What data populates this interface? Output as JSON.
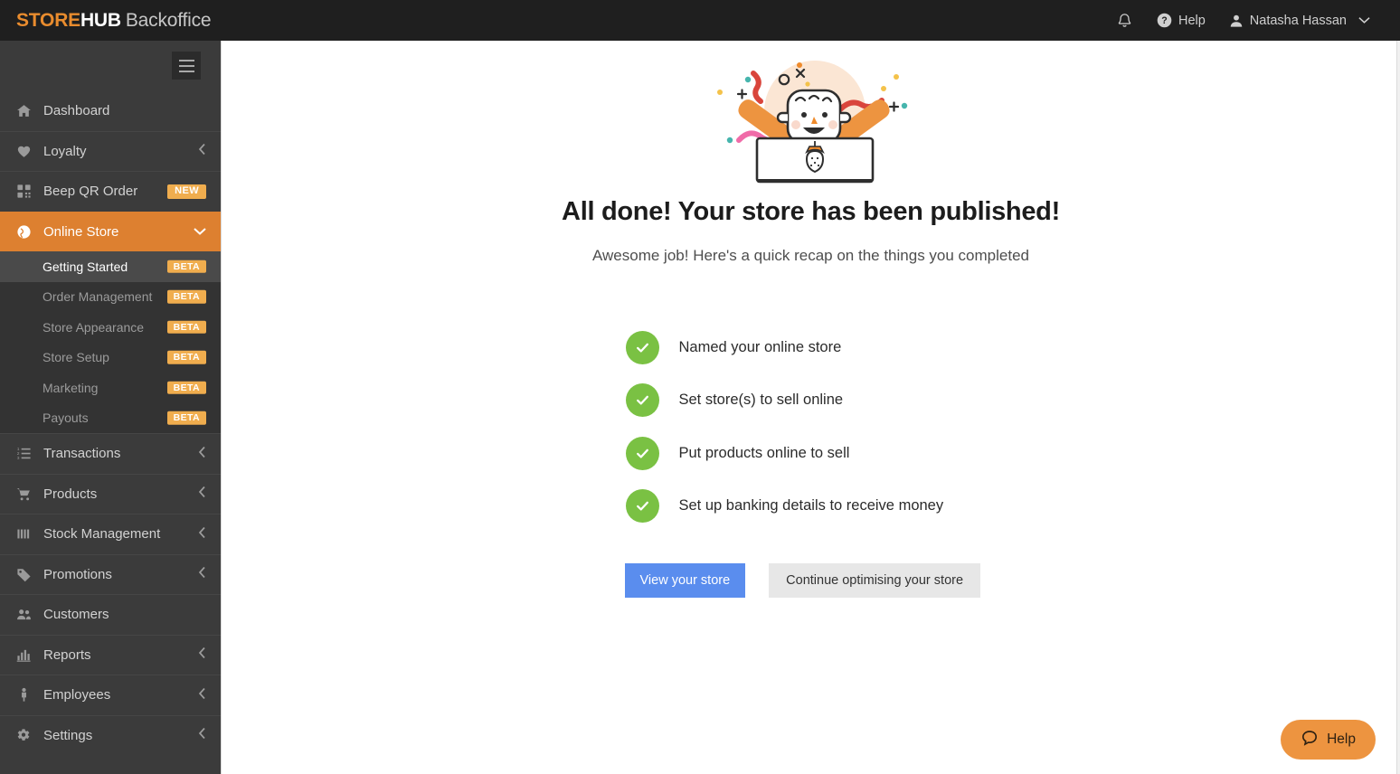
{
  "header": {
    "brand_part1": "STORE",
    "brand_part2": "HUB",
    "brand_part3": "Backoffice",
    "notifications_icon": "bell-icon",
    "help_label": "Help",
    "user_name": "Natasha Hassan"
  },
  "sidebar": {
    "menu_toggle": "hamburger-icon",
    "items": [
      {
        "label": "Dashboard",
        "icon": "home-icon",
        "chevron": "none",
        "badge": ""
      },
      {
        "label": "Loyalty",
        "icon": "heart-icon",
        "chevron": "left",
        "badge": ""
      },
      {
        "label": "Beep QR Order",
        "icon": "qr-code-icon",
        "chevron": "none",
        "badge": "NEW"
      },
      {
        "label": "Online Store",
        "icon": "globe-icon",
        "chevron": "down",
        "badge": "",
        "active": true
      },
      {
        "label": "Transactions",
        "icon": "list-ol-icon",
        "chevron": "left",
        "badge": ""
      },
      {
        "label": "Products",
        "icon": "cart-icon",
        "chevron": "left",
        "badge": ""
      },
      {
        "label": "Stock Management",
        "icon": "bars-icon",
        "chevron": "left",
        "badge": ""
      },
      {
        "label": "Promotions",
        "icon": "tag-icon",
        "chevron": "left",
        "badge": ""
      },
      {
        "label": "Customers",
        "icon": "users-icon",
        "chevron": "none",
        "badge": ""
      },
      {
        "label": "Reports",
        "icon": "chart-bar-icon",
        "chevron": "left",
        "badge": ""
      },
      {
        "label": "Employees",
        "icon": "person-icon",
        "chevron": "left",
        "badge": ""
      },
      {
        "label": "Settings",
        "icon": "gears-icon",
        "chevron": "left",
        "badge": ""
      }
    ],
    "submenu": [
      {
        "label": "Getting Started",
        "badge": "BETA",
        "active": true
      },
      {
        "label": "Order Management",
        "badge": "BETA",
        "active": false
      },
      {
        "label": "Store Appearance",
        "badge": "BETA",
        "active": false
      },
      {
        "label": "Store Setup",
        "badge": "BETA",
        "active": false
      },
      {
        "label": "Marketing",
        "badge": "BETA",
        "active": false
      },
      {
        "label": "Payouts",
        "badge": "BETA",
        "active": false
      }
    ]
  },
  "main": {
    "illustration": "person-popping-out-of-box-with-confetti-illustration",
    "headline": "All done! Your store has been published!",
    "subhead": "Awesome job! Here's a quick recap on the things you completed",
    "checklist": [
      {
        "label": "Named your online store",
        "state": "complete"
      },
      {
        "label": "Set store(s) to sell online",
        "state": "complete"
      },
      {
        "label": "Put products online to sell",
        "state": "complete"
      },
      {
        "label": "Set up banking details to receive money",
        "state": "complete"
      }
    ],
    "primary_button": "View your store",
    "secondary_button": "Continue optimising your store"
  },
  "help_widget": {
    "label": "Help",
    "icon": "speech-bubble-icon"
  },
  "colors": {
    "brand_orange": "#e98c2e",
    "active_nav": "#dd8030",
    "badge_amber": "#f0ad4e",
    "check_green": "#7ac143",
    "primary_blue": "#5a8dee",
    "secondary_gray": "#e7e7e7",
    "topbar_dark": "#1f1f1f",
    "sidebar_dark": "#3b3b3b",
    "help_widget_orange": "#ed9440"
  }
}
